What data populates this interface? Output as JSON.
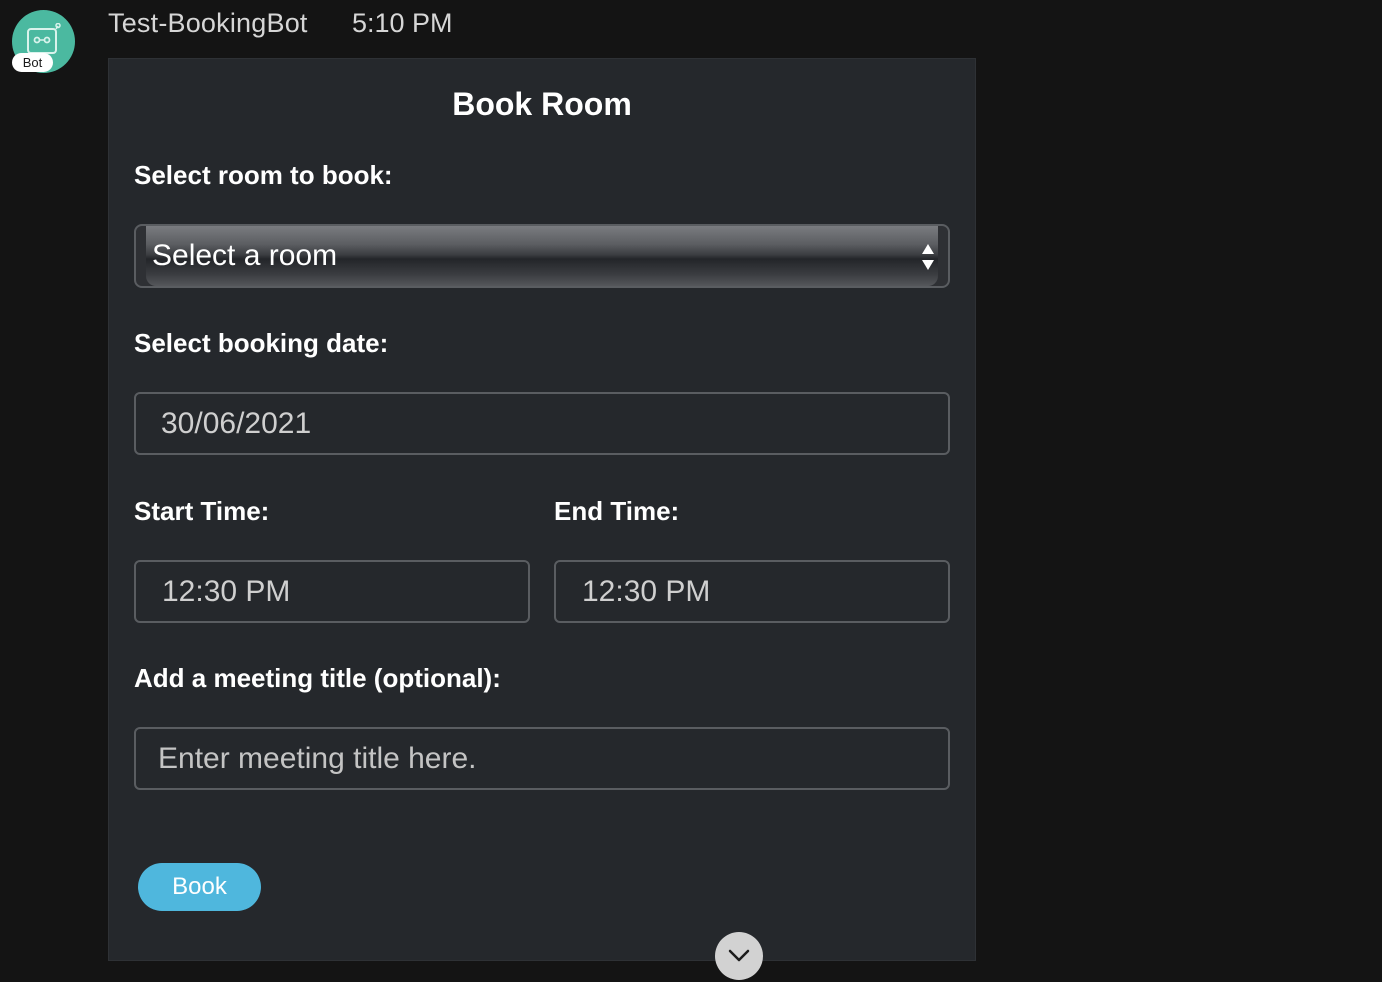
{
  "message": {
    "sender": "Test-BookingBot",
    "timestamp": "5:10 PM",
    "avatar_badge": "Bot"
  },
  "card": {
    "title": "Book Room",
    "room": {
      "label": "Select room to book:",
      "selected": "Select a room"
    },
    "date": {
      "label": "Select booking date:",
      "value": "30/06/2021"
    },
    "start_time": {
      "label": "Start Time:",
      "value": "12:30 PM"
    },
    "end_time": {
      "label": "End Time:",
      "value": "12:30 PM"
    },
    "meeting_title": {
      "label": "Add a meeting title (optional):",
      "placeholder": "Enter meeting title here."
    },
    "book_button": "Book"
  },
  "colors": {
    "background": "#141414",
    "card": "#25282c",
    "avatar": "#4bb9a0",
    "accent_button": "#4fb7dd"
  },
  "icons": {
    "avatar": "robot-icon",
    "select": "updown-arrows-icon",
    "scroll": "chevron-down-icon"
  }
}
